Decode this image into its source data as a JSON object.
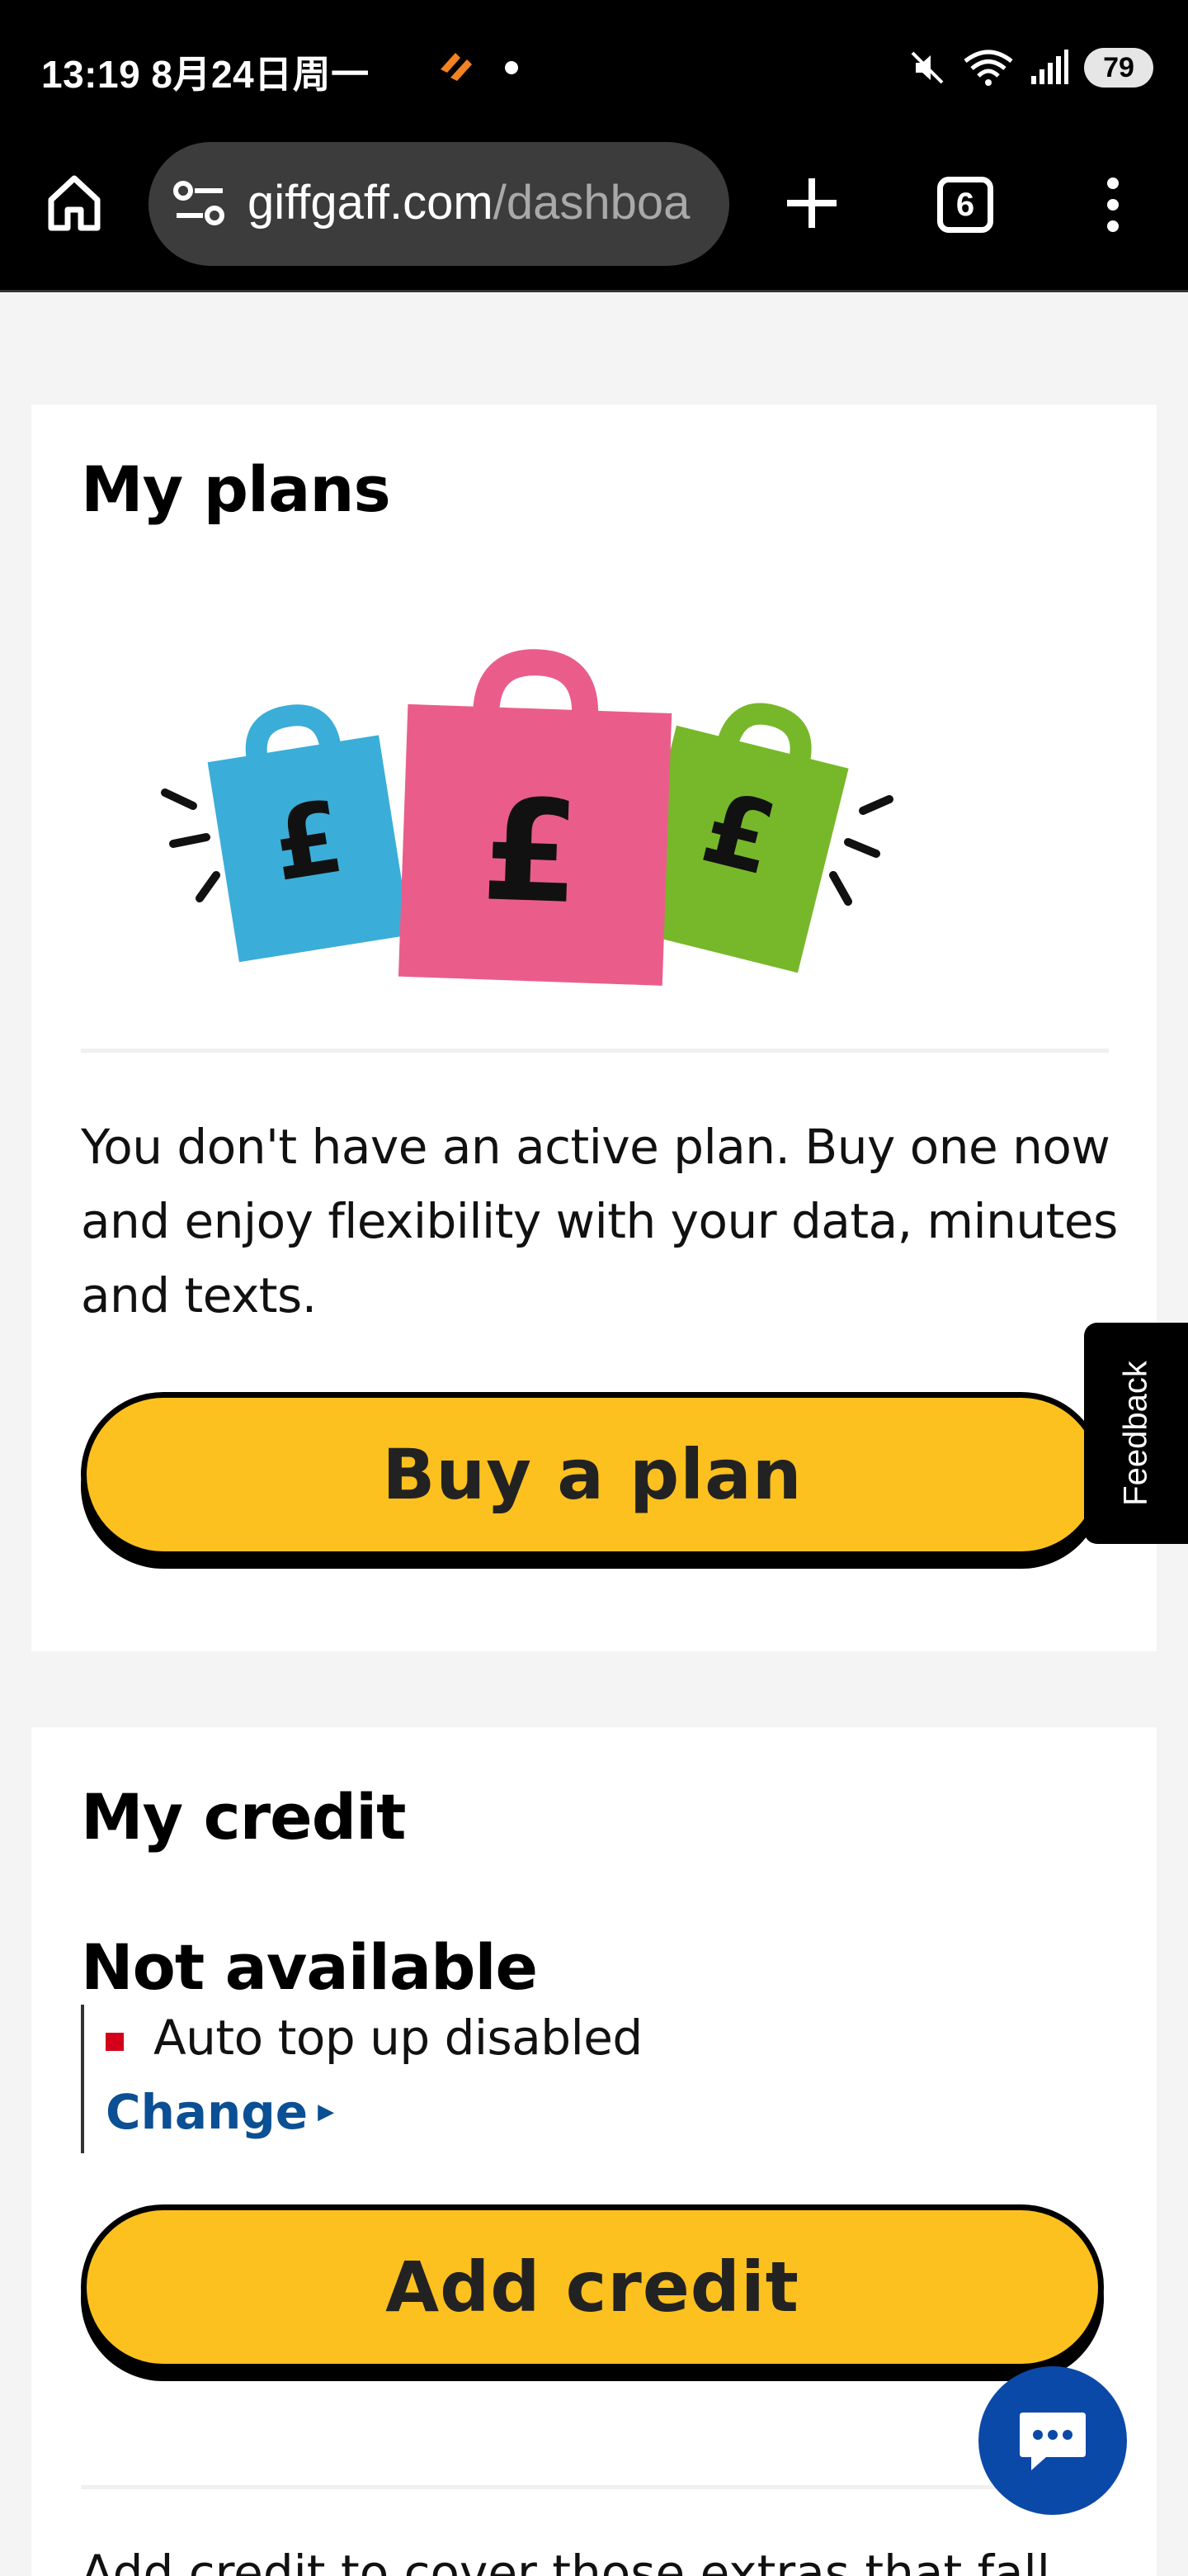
{
  "status_bar": {
    "time_date": "13:19  8月24日周一",
    "battery": "79"
  },
  "browser": {
    "url_domain": "giffgaff.com",
    "url_path": "/dashboa",
    "tab_count": "6"
  },
  "plans_card": {
    "title": "My plans",
    "message": "You don't have an active plan. Buy one now and enjoy flexibility with your data, minutes and texts.",
    "buy_button": "Buy a plan",
    "illustration_symbol": "£",
    "bag_colors": [
      "#3aaed8",
      "#ea5d8b",
      "#76b82a"
    ]
  },
  "credit_card": {
    "title": "My credit",
    "credit_status": "Not available",
    "auto_topup_status": "Auto top up disabled",
    "change_link": "Change",
    "add_button": "Add credit",
    "footer_text": "Add credit to cover those extras that fall"
  },
  "feedback_tab": {
    "label": "Feedback"
  },
  "colors": {
    "accent_yellow": "#fcc01f",
    "link_blue": "#0b4f94",
    "chat_blue": "#0b49a8",
    "status_red": "#d4001a"
  },
  "icons": [
    "home-icon",
    "site-settings-icon",
    "plus-icon",
    "tabs-icon",
    "more-vert-icon",
    "mute-icon",
    "wifi-icon",
    "signal-icon",
    "chat-icon"
  ]
}
